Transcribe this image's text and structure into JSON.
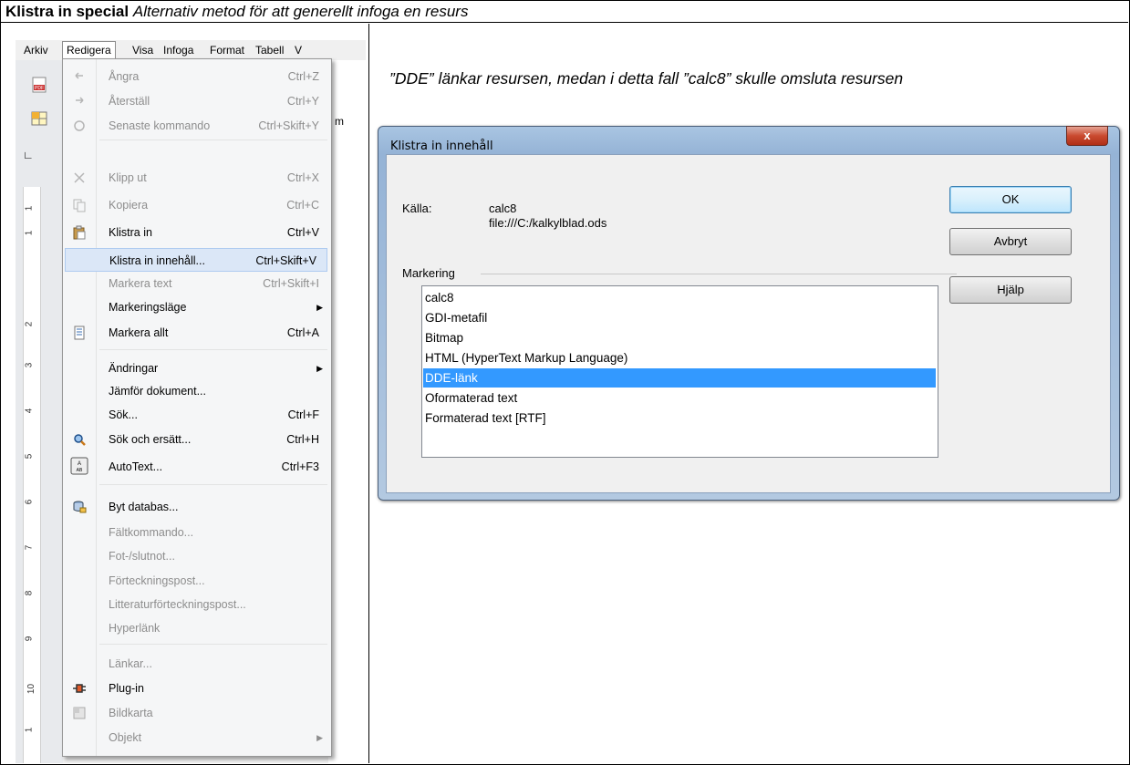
{
  "heading": {
    "bold": "Klistra in special",
    "italic": "Alternativ metod för att generellt infoga en resurs"
  },
  "menubar": [
    "Arkiv",
    "Redigera",
    "Visa",
    "Infoga",
    "Format",
    "Tabell",
    "V"
  ],
  "ruler_numbers": [
    "1",
    "1",
    "2",
    "3",
    "4",
    "5",
    "6",
    "7",
    "8",
    "9",
    "10",
    "1"
  ],
  "menu_items": [
    {
      "label": "Ångra",
      "accel": "Ctrl+Z",
      "disabled": true,
      "icon": "undo-icon"
    },
    {
      "label": "Återställ",
      "accel": "Ctrl+Y",
      "disabled": true,
      "icon": "redo-icon"
    },
    {
      "label": "Senaste kommando",
      "accel": "Ctrl+Skift+Y",
      "disabled": true,
      "icon": "repeat-icon"
    },
    {
      "label": "Klipp ut",
      "accel": "Ctrl+X",
      "disabled": true,
      "icon": "cut-icon"
    },
    {
      "label": "Kopiera",
      "accel": "Ctrl+C",
      "disabled": true,
      "icon": "copy-icon"
    },
    {
      "label": "Klistra in",
      "accel": "Ctrl+V",
      "disabled": false,
      "icon": "paste-icon"
    },
    {
      "label": "Klistra in innehåll...",
      "accel": "Ctrl+Skift+V",
      "disabled": false,
      "highlight": true
    },
    {
      "label": "Markera text",
      "accel": "Ctrl+Skift+I",
      "disabled": true
    },
    {
      "label": "Markeringsläge",
      "accel": "",
      "submenu": true
    },
    {
      "label": "Markera allt",
      "accel": "Ctrl+A",
      "icon": "select-all-icon"
    },
    {
      "label": "Ändringar",
      "accel": "",
      "submenu": true
    },
    {
      "label": "Jämför dokument...",
      "accel": ""
    },
    {
      "label": "Sök...",
      "accel": "Ctrl+F"
    },
    {
      "label": "Sök och ersätt...",
      "accel": "Ctrl+H",
      "icon": "find-replace-icon"
    },
    {
      "label": "AutoText...",
      "accel": "Ctrl+F3",
      "icon": "autotext-icon"
    },
    {
      "label": "Byt databas...",
      "accel": "",
      "icon": "database-icon"
    },
    {
      "label": "Fältkommando...",
      "accel": "",
      "disabled": true
    },
    {
      "label": "Fot-/slutnot...",
      "accel": "",
      "disabled": true
    },
    {
      "label": "Förteckningspost...",
      "accel": "",
      "disabled": true
    },
    {
      "label": "Litteraturförteckningspost...",
      "accel": "",
      "disabled": true
    },
    {
      "label": "Hyperlänk",
      "accel": "",
      "disabled": true
    },
    {
      "label": "Länkar...",
      "accel": "",
      "disabled": true
    },
    {
      "label": "Plug-in",
      "accel": "",
      "icon": "plugin-icon"
    },
    {
      "label": "Bildkarta",
      "accel": "",
      "disabled": true,
      "icon": "imagemap-icon"
    },
    {
      "label": "Objekt",
      "accel": "",
      "disabled": true,
      "submenu": true
    }
  ],
  "caption": "”DDE” länkar resursen, medan i detta fall ”calc8” skulle omsluta resursen",
  "dialog": {
    "title": "Klistra in innehåll",
    "close": "x",
    "source_label": "Källa:",
    "source_name": "calc8",
    "source_file": "file:///C:/kalkylblad.ods",
    "selection_label": "Markering",
    "options": [
      "calc8",
      "GDI-metafil",
      "Bitmap",
      "HTML (HyperText Markup Language)",
      "DDE-länk",
      "Oformaterad text",
      "Formaterad text [RTF]"
    ],
    "selected_option": "DDE-länk",
    "ok": "OK",
    "cancel": "Avbryt",
    "help": "Hjälp"
  },
  "colors": {
    "selection": "#3399ff",
    "menu_highlight": "#dbe7f7"
  }
}
